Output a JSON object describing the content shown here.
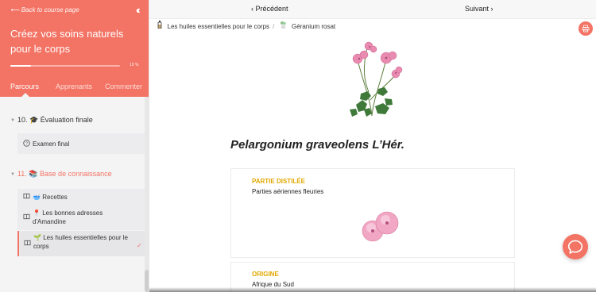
{
  "sidebar": {
    "back_link": "Back to course page",
    "course_title": "Créez vos soins naturels pour le corps",
    "progress": {
      "value": 0.19,
      "label": "19 %"
    },
    "tabs": [
      {
        "label": "Parcours",
        "active": true
      },
      {
        "label": "Apprenants",
        "active": false
      },
      {
        "label": "Commenter",
        "active": false
      }
    ],
    "sections": [
      {
        "number": "10.",
        "icon": "🎓",
        "title": "Évaluation finale",
        "lessons": [
          {
            "icon": "question-circle-icon",
            "label": "Examen final"
          }
        ]
      },
      {
        "number": "11.",
        "icon": "📚",
        "title": "Base de connaissance",
        "active": true,
        "lessons": [
          {
            "icon": "book-icon",
            "emoji": "🥣",
            "label": "Recettes"
          },
          {
            "icon": "book-icon",
            "emoji": "📍",
            "label": "Les bonnes adresses d'Amandine"
          },
          {
            "icon": "book-icon",
            "emoji": "🌱",
            "label": "Les huiles essentielles pour le corps",
            "active": true,
            "completed": true
          }
        ]
      }
    ]
  },
  "nav": {
    "prev": "Précédent",
    "next": "Suivant"
  },
  "breadcrumb": [
    {
      "icon": "bottle-icon",
      "label": "Les huiles essentielles pour le corps"
    },
    {
      "icon": "plant-icon",
      "label": "Géranium rosat"
    }
  ],
  "content": {
    "species": "Pelargonium graveolens L’Hér.",
    "cards": [
      {
        "label": "PARTIE DISTILÉE",
        "value": "Parties aériennes fleuries"
      },
      {
        "label": "ORIGINE",
        "value": "Afrique du Sud"
      }
    ]
  },
  "colors": {
    "accent": "#f37364",
    "label_gold": "#e0a800",
    "sidebar_bg": "#f4f4f5"
  },
  "icons": {
    "print": "print-icon",
    "chat": "chat-bubble-icon",
    "collapse": "double-chevron-left-icon"
  }
}
